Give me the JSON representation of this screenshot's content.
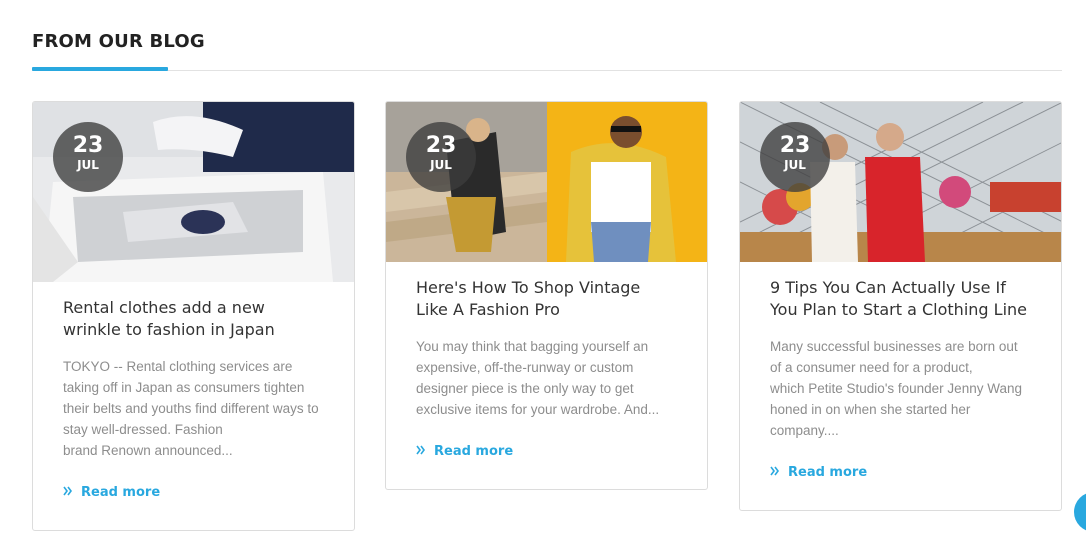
{
  "section": {
    "title": "FROM OUR BLOG",
    "accent_color": "#29a8df"
  },
  "posts": [
    {
      "day": "23",
      "month": "JUL",
      "title": "Rental clothes add a new wrinkle to fashion in Japan",
      "excerpt": "TOKYO -- Rental clothing services are taking off in Japan as consumers tighten their belts and youths find different ways to stay well-dressed. Fashion\nbrand Renown announced...",
      "read_more": "Read more",
      "image_icon": "clothing-box-photo"
    },
    {
      "day": "23",
      "month": "JUL",
      "title": "Here's How To Shop Vintage Like A Fashion Pro",
      "excerpt": "You may think that bagging yourself an expensive, off-the-runway or custom designer piece is the only way to get exclusive items for your wardrobe. And...",
      "read_more": "Read more",
      "image_icon": "vintage-fashion-photo"
    },
    {
      "day": "23",
      "month": "JUL",
      "title": "9 Tips You Can Actually Use If You Plan to Start a Clothing Line",
      "excerpt": "Many successful businesses are born out of a consumer need for a product,\nwhich Petite Studio's founder Jenny Wang honed in on when she started her company....",
      "read_more": "Read more",
      "image_icon": "models-fair-photo"
    }
  ]
}
